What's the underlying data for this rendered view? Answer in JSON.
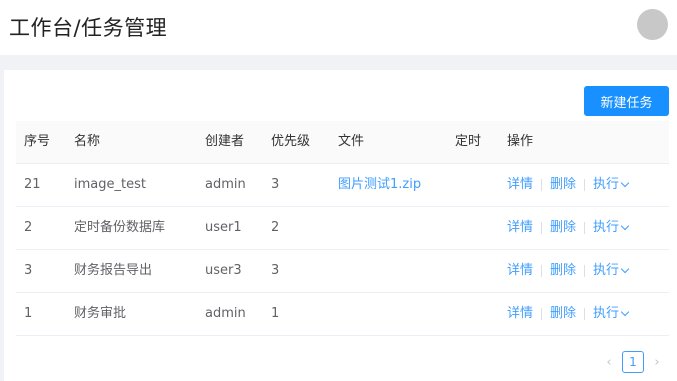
{
  "header": {
    "title": "工作台/任务管理"
  },
  "toolbar": {
    "new_task_label": "新建任务"
  },
  "table": {
    "columns": [
      "序号",
      "名称",
      "创建者",
      "优先级",
      "文件",
      "定时",
      "操作"
    ],
    "rows": [
      {
        "idx": "21",
        "name": "image_test",
        "creator": "admin",
        "priority": "3",
        "file": "图片测试1.zip",
        "timer": ""
      },
      {
        "idx": "2",
        "name": "定时备份数据库",
        "creator": "user1",
        "priority": "2",
        "file": "",
        "timer": ""
      },
      {
        "idx": "3",
        "name": "财务报告导出",
        "creator": "user3",
        "priority": "3",
        "file": "",
        "timer": ""
      },
      {
        "idx": "1",
        "name": "财务审批",
        "creator": "admin",
        "priority": "1",
        "file": "",
        "timer": ""
      }
    ],
    "actions": {
      "detail": "详情",
      "delete": "删除",
      "execute": "执行"
    }
  },
  "pagination": {
    "current_page": "1",
    "prev": "‹",
    "next": "›"
  },
  "colors": {
    "primary": "#1890ff",
    "link": "#409eff",
    "band": "#f0f2f5"
  }
}
